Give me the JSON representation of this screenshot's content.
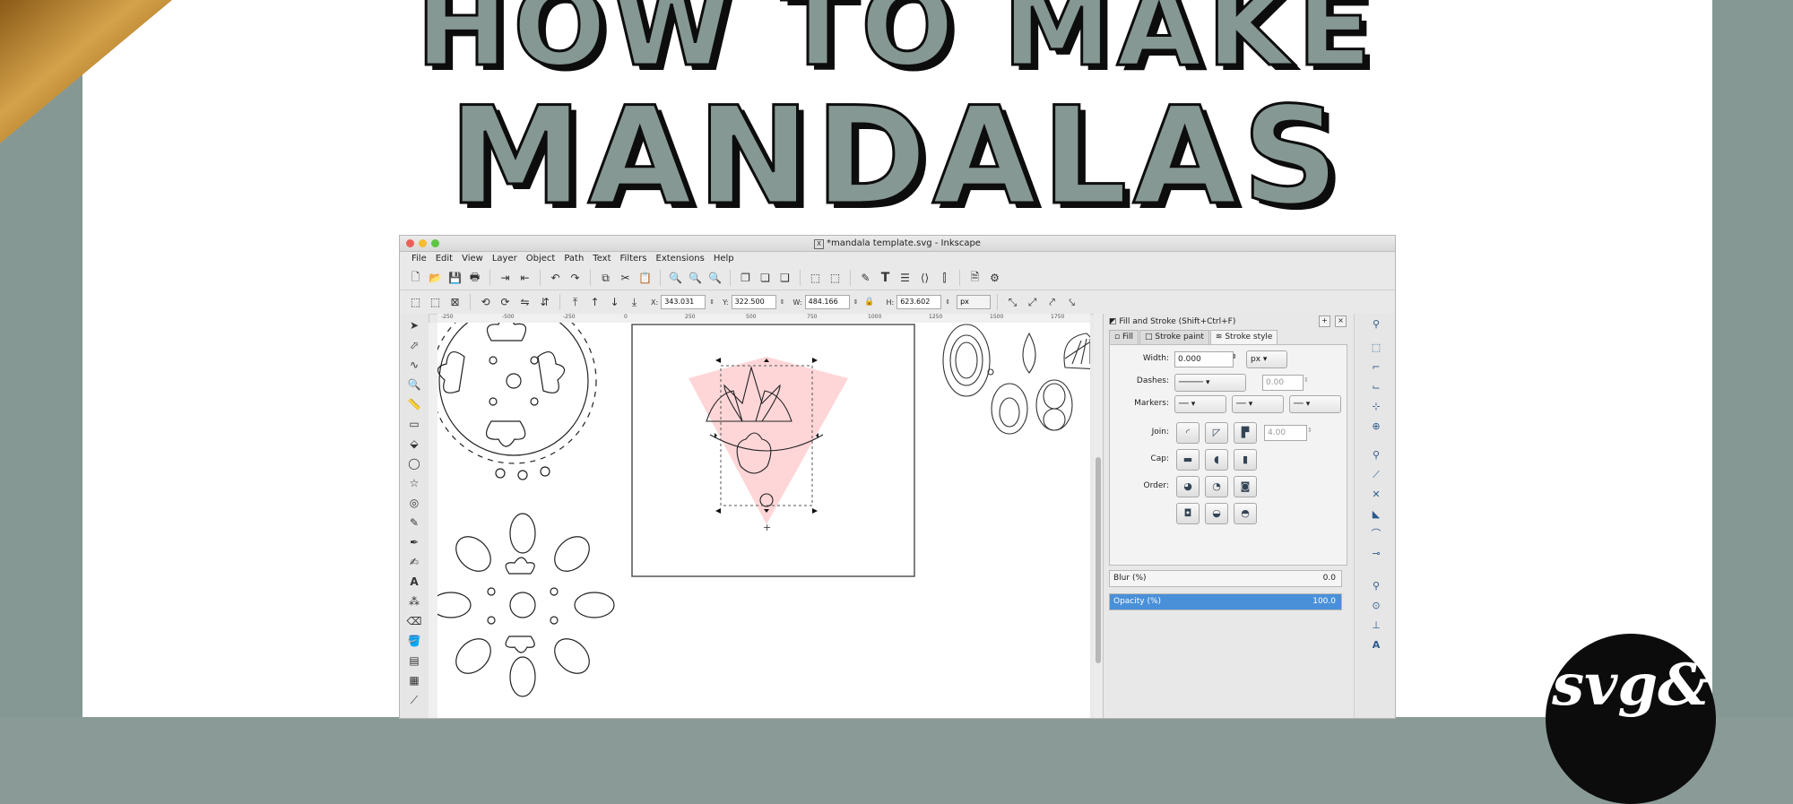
{
  "headline": {
    "line1": "HOW TO MAKE",
    "line2": "MANDALAS"
  },
  "colors": {
    "sage": "#869894",
    "ink": "#0d0d0d",
    "highlight_pink": "#ffd6d8",
    "opacity_blue": "#4a90d9"
  },
  "window": {
    "title": "*mandala template.svg - Inkscape",
    "menu": [
      "File",
      "Edit",
      "View",
      "Layer",
      "Object",
      "Path",
      "Text",
      "Filters",
      "Extensions",
      "Help"
    ]
  },
  "controls": {
    "x_label": "X:",
    "x_value": "343.031",
    "y_label": "Y:",
    "y_value": "322.500",
    "w_label": "W:",
    "w_value": "484.166",
    "h_label": "H:",
    "h_value": "623.602",
    "unit": "px"
  },
  "ruler": {
    "ticks": [
      "-250",
      "-500",
      "-250",
      "0",
      "250",
      "500",
      "750",
      "1000",
      "1250",
      "1500",
      "1750"
    ]
  },
  "panel": {
    "title": "Fill and Stroke (Shift+Ctrl+F)",
    "tabs": [
      "Fill",
      "Stroke paint",
      "Stroke style"
    ],
    "width_label": "Width:",
    "width_value": "0.000",
    "width_unit": "px",
    "dashes_label": "Dashes:",
    "dashes_value": "0.00",
    "markers_label": "Markers:",
    "join_label": "Join:",
    "miter_value": "4.00",
    "cap_label": "Cap:",
    "order_label": "Order:",
    "blur_label": "Blur (%)",
    "blur_value": "0.0",
    "opacity_label": "Opacity (%)",
    "opacity_value": "100.0"
  },
  "logo": {
    "text": "svg&"
  }
}
